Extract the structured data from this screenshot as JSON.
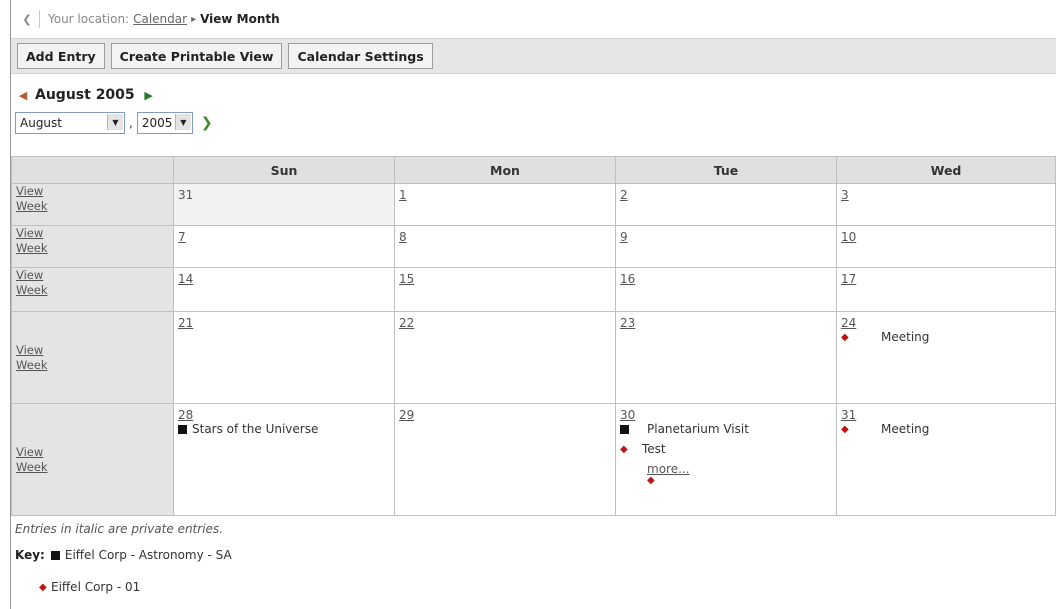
{
  "breadcrumb": {
    "prefix": "Your location:",
    "link": "Calendar",
    "current": "View Month"
  },
  "toolbar": {
    "add_entry": "Add Entry",
    "printable": "Create Printable View",
    "settings": "Calendar Settings"
  },
  "month_title": "August 2005",
  "selectors": {
    "month": "August",
    "year": "2005"
  },
  "days": {
    "sun": "Sun",
    "mon": "Mon",
    "tue": "Tue",
    "wed": "Wed"
  },
  "view_week": {
    "line1": "View",
    "line2": "Week"
  },
  "weeks": [
    {
      "sun": "31",
      "mon": "1",
      "tue": "2",
      "wed": "3"
    },
    {
      "sun": "7",
      "mon": "8",
      "tue": "9",
      "wed": "10"
    },
    {
      "sun": "14",
      "mon": "15",
      "tue": "16",
      "wed": "17"
    },
    {
      "sun": "21",
      "mon": "22",
      "tue": "23",
      "wed": "24",
      "wed_entries": [
        "Meeting"
      ]
    },
    {
      "sun": "28",
      "mon": "29",
      "tue": "30",
      "wed": "31",
      "sun_entries": [
        "Stars of the Universe"
      ],
      "tue_entries": [
        "Planetarium Visit",
        "Test"
      ],
      "tue_more": "more...",
      "wed_entries": [
        "Meeting"
      ]
    }
  ],
  "footer": {
    "note": "Entries in italic are private entries.",
    "key_label": "Key:",
    "key1": "Eiffel Corp - Astronomy - SA",
    "key2": "Eiffel Corp - 01"
  },
  "colors": {
    "astronomy_marker": "#111111",
    "corp01_marker": "#c01010",
    "header_bg": "#e0e0e0"
  }
}
